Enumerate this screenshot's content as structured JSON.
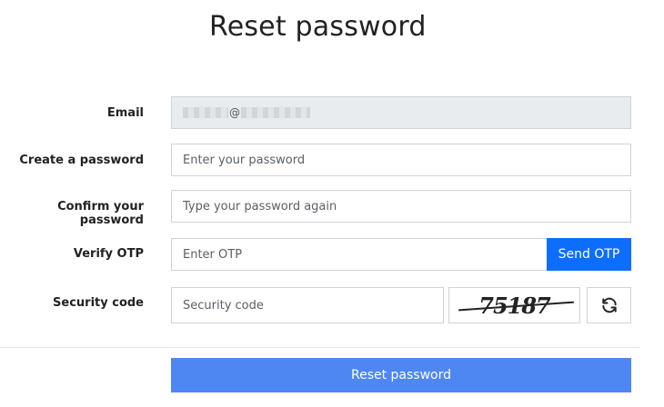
{
  "page": {
    "title": "Reset password"
  },
  "form": {
    "email": {
      "label": "Email",
      "at_symbol": "@"
    },
    "password": {
      "label": "Create a password",
      "placeholder": "Enter your password"
    },
    "confirm": {
      "label": "Confirm your password",
      "placeholder": "Type your password again"
    },
    "otp": {
      "label": "Verify OTP",
      "placeholder": "Enter OTP",
      "send_label": "Send OTP"
    },
    "security": {
      "label": "Security code",
      "placeholder": "Security code",
      "captcha_text": "75187",
      "refresh_icon": "refresh-icon"
    },
    "submit_label": "Reset password"
  },
  "colors": {
    "primary": "#0d6efd",
    "submit": "#4f87f2",
    "readonly_bg": "#e9ecef"
  }
}
